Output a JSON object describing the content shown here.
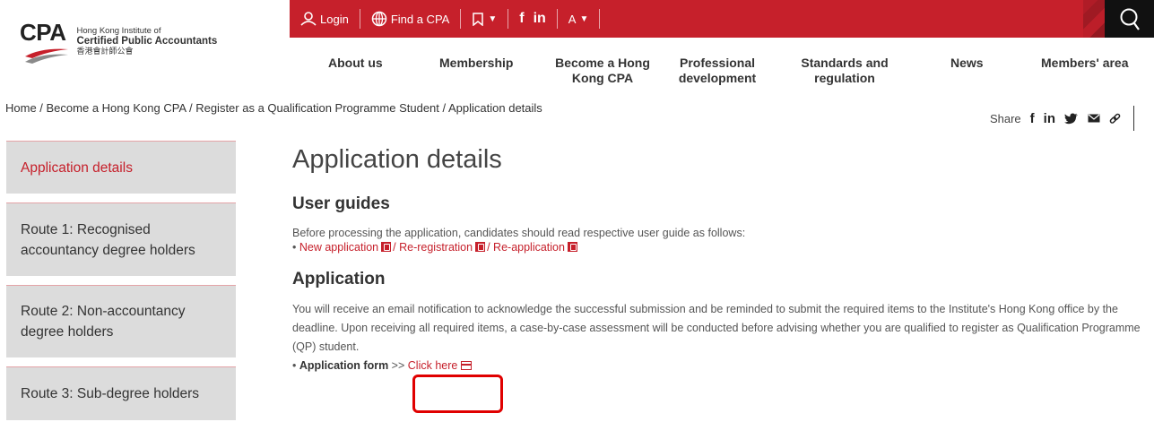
{
  "logo": {
    "mark": "CPA",
    "line1": "Hong Kong Institute of",
    "line2": "Certified Public Accountants",
    "line3": "香港會計師公會"
  },
  "topbar": {
    "login": "Login",
    "find_cpa": "Find a CPA",
    "font_size": "A",
    "facebook": "f",
    "linkedin": "in"
  },
  "nav": [
    {
      "label": "About us"
    },
    {
      "label": "Membership"
    },
    {
      "label": "Become a Hong Kong CPA"
    },
    {
      "label": "Professional development"
    },
    {
      "label": "Standards and regulation"
    },
    {
      "label": "News"
    },
    {
      "label": "Members' area"
    }
  ],
  "breadcrumb": "Home / Become a Hong Kong CPA / Register as a Qualification Programme Student / Application details",
  "share": {
    "label": "Share",
    "facebook": "f",
    "linkedin": "in"
  },
  "sidebar": {
    "items": [
      {
        "label": "Application details"
      },
      {
        "label": "Route 1: Recognised accountancy degree holders"
      },
      {
        "label": "Route 2: Non-accountancy degree holders"
      },
      {
        "label": "Route 3: Sub-degree holders"
      }
    ]
  },
  "main": {
    "title": "Application details",
    "user_guides": {
      "heading": "User guides",
      "intro": "Before processing the application, candidates should read respective user guide as follows:",
      "bullet": "•",
      "links": [
        "New application",
        "Re-registration",
        "Re-application"
      ],
      "separator": "/"
    },
    "application": {
      "heading": "Application",
      "paragraph": "You will receive an email notification to acknowledge the successful submission and be reminded to submit the required items to the Institute's Hong Kong office by the deadline. Upon receiving all required items, a case-by-case assessment will be conducted before advising whether you are qualified to register as Qualification Programme (QP) student.",
      "form_label": "Application form",
      "arrows": ">>",
      "click_here": "Click here"
    }
  },
  "colors": {
    "brand_red": "#c6202b",
    "sidebar_bg": "#dcdcdc",
    "highlight": "#e00000"
  }
}
